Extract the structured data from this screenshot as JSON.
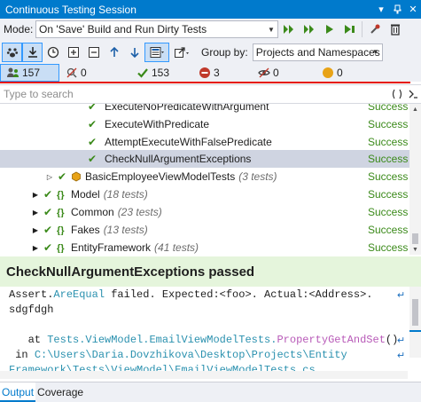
{
  "window": {
    "title": "Continuous Testing Session",
    "pin_glyph": "▾",
    "pushpin_glyph": "⊣",
    "close_glyph": "✕"
  },
  "mode": {
    "label": "Mode:",
    "value": "On 'Save' Build and Run Dirty Tests"
  },
  "toolbar": {
    "group_by_label": "Group by:",
    "group_by_value": "Projects and Namespaces"
  },
  "counters": [
    {
      "name": "all",
      "value": "157"
    },
    {
      "name": "ignored",
      "value": "0"
    },
    {
      "name": "passed",
      "value": "153"
    },
    {
      "name": "failed",
      "value": "3"
    },
    {
      "name": "hidden",
      "value": "0"
    },
    {
      "name": "inconclusive",
      "value": "0"
    }
  ],
  "search": {
    "placeholder": "Type to search"
  },
  "tree": {
    "rows": [
      {
        "name": "ExecuteNoPredicateWithArgument",
        "count": "",
        "status": "Success"
      },
      {
        "name": "ExecuteWithPredicate",
        "count": "",
        "status": "Success"
      },
      {
        "name": "AttemptExecuteWithFalsePredicate",
        "count": "",
        "status": "Success"
      },
      {
        "name": "CheckNullArgumentExceptions",
        "count": "",
        "status": "Success"
      },
      {
        "name": "BasicEmployeeViewModelTests",
        "count": "(3 tests)",
        "status": "Success"
      },
      {
        "name": "Model",
        "count": "(18 tests)",
        "status": "Success"
      },
      {
        "name": "Common",
        "count": "(23 tests)",
        "status": "Success"
      },
      {
        "name": "Fakes",
        "count": "(13 tests)",
        "status": "Success"
      },
      {
        "name": "EntityFramework",
        "count": "(41 tests)",
        "status": "Success"
      }
    ]
  },
  "result": {
    "title": "CheckNullArgumentExceptions passed"
  },
  "output": {
    "line1_a": "Assert.",
    "line1_b": "AreEqual",
    "line1_c": " failed. Expected:<foo>. Actual:<Address>.",
    "line2": "sdgfdgh",
    "line3_a": "   at ",
    "line3_b": "Tests.ViewModel.EmailViewModelTests.",
    "line3_c": "PropertyGetAndSet",
    "line3_d": "()",
    "line4_a": " in ",
    "line4_b": "C:\\Users\\Daria.Dovzhikova\\Desktop\\Projects\\Entity",
    "line5": "Framework\\Tests\\ViewModel\\EmailViewModelTests.cs",
    "wrap_glyph": "↵"
  },
  "tabs": [
    {
      "label": "Output",
      "active": true
    },
    {
      "label": "Coverage",
      "active": false
    }
  ],
  "colors": {
    "accent": "#007acc",
    "success": "#3b8a1a",
    "fail_line": "#e51400",
    "result_bg": "#e5f5dc"
  }
}
